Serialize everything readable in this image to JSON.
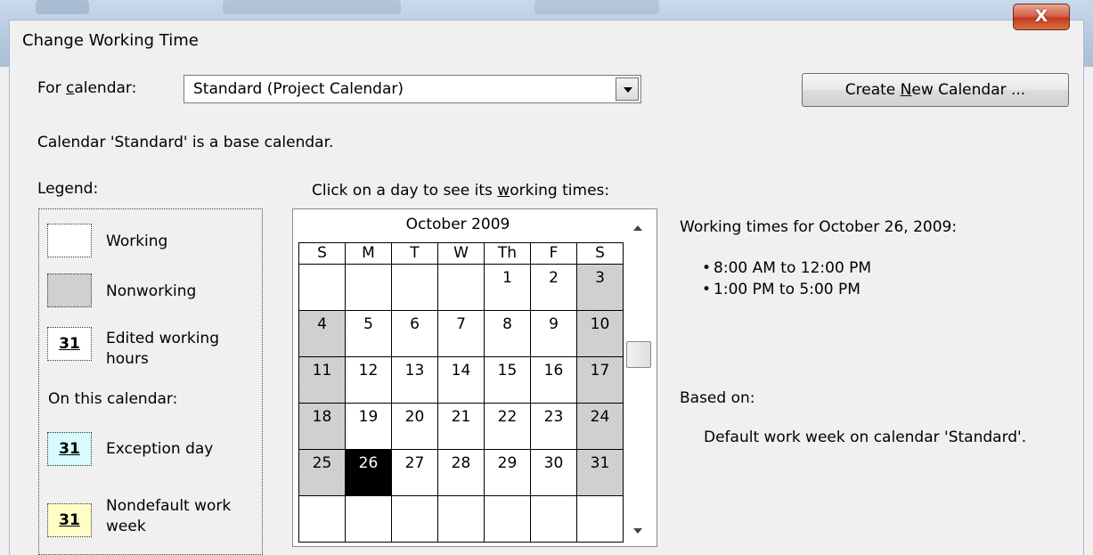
{
  "window": {
    "title": "Change Working Time",
    "close_label": "X"
  },
  "calendar_select": {
    "label_pre": "For ",
    "label_key": "c",
    "label_post": "alendar:",
    "value": "Standard (Project Calendar)"
  },
  "create_button": {
    "label_pre": "Create ",
    "label_key": "N",
    "label_post": "ew Calendar ..."
  },
  "base_note": "Calendar 'Standard' is a base calendar.",
  "legend": {
    "title": "Legend:",
    "working": "Working",
    "nonworking": "Nonworking",
    "edited_line1": "Edited working",
    "edited_line2": "hours",
    "swatch_number": "31",
    "on_calendar": "On this calendar:",
    "exception": "Exception day",
    "nondefault_line1": "Nondefault work",
    "nondefault_line2": "week"
  },
  "colors": {
    "exception_swatch": "#d8fbfd",
    "nondefault_swatch": "#fefec6",
    "selected_day": "#000000"
  },
  "prompt": {
    "pre": "Click on a day to see its ",
    "key": "w",
    "post": "orking times:"
  },
  "calendar": {
    "month": "October 2009",
    "weekdays": [
      "S",
      "M",
      "T",
      "W",
      "Th",
      "F",
      "S"
    ],
    "weeks": [
      [
        "",
        "",
        "",
        "",
        "1",
        "2",
        "3"
      ],
      [
        "4",
        "5",
        "6",
        "7",
        "8",
        "9",
        "10"
      ],
      [
        "11",
        "12",
        "13",
        "14",
        "15",
        "16",
        "17"
      ],
      [
        "18",
        "19",
        "20",
        "21",
        "22",
        "23",
        "24"
      ],
      [
        "25",
        "26",
        "27",
        "28",
        "29",
        "30",
        "31"
      ],
      [
        "",
        "",
        "",
        "",
        "",
        "",
        ""
      ]
    ],
    "selected_day": "26"
  },
  "working_times": {
    "heading": "Working times for October 26, 2009:",
    "items": [
      "8:00 AM to 12:00 PM",
      "1:00 PM to 5:00 PM"
    ]
  },
  "based_on": {
    "label": "Based on:",
    "text": "Default work week on calendar 'Standard'."
  }
}
